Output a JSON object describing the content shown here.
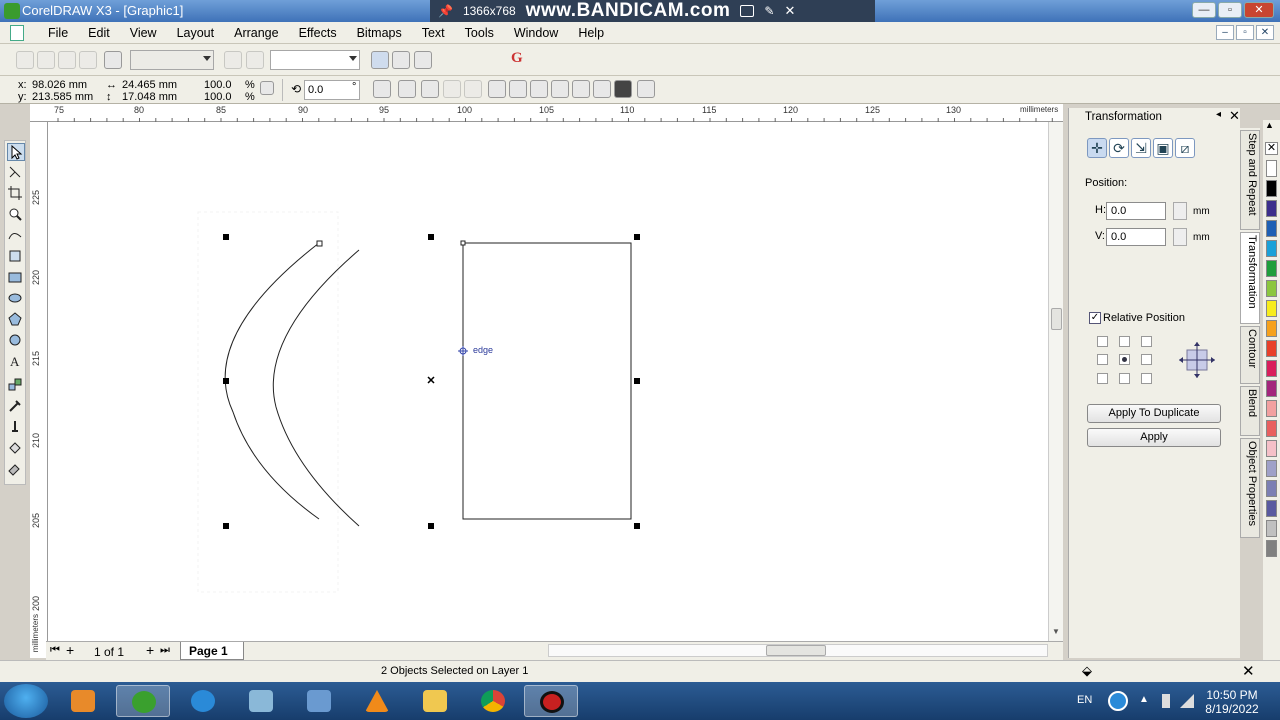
{
  "window": {
    "title": "CorelDRAW X3 - [Graphic1]",
    "recorder_resolution": "1366x768",
    "recorder_brand": "www.BANDICAM.com",
    "min_label": "—",
    "max_label": "▫",
    "close_label": "✕"
  },
  "menu": {
    "items": [
      "File",
      "Edit",
      "View",
      "Layout",
      "Arrange",
      "Effects",
      "Bitmaps",
      "Text",
      "Tools",
      "Window",
      "Help"
    ]
  },
  "toolbar": {
    "x_label": "x:",
    "x_value": "98.026 mm",
    "y_label": "y:",
    "y_value": "213.585 mm",
    "width_value": "24.465 mm",
    "height_value": "17.048 mm",
    "scale_x": "100.0",
    "scale_y": "100.0",
    "percent": "%",
    "rotation": "0.0",
    "degree": "°"
  },
  "rulers": {
    "unit": "millimeters",
    "h_ticks": [
      "75",
      "80",
      "85",
      "90",
      "95",
      "100",
      "105",
      "110",
      "115",
      "120",
      "125",
      "130"
    ],
    "v_ticks": [
      "225",
      "220",
      "215",
      "210",
      "205",
      "200"
    ]
  },
  "canvas": {
    "snap_label": "edge"
  },
  "page_nav": {
    "counter": "1 of 1",
    "page_tab": "Page 1"
  },
  "status": {
    "text": "2 Objects Selected on Layer 1"
  },
  "docker": {
    "title": "Transformation",
    "position_label": "Position:",
    "h_label": "H:",
    "h_value": "0.0",
    "v_label": "V:",
    "v_value": "0.0",
    "unit": "mm",
    "relative_position_label": "Relative Position",
    "relative_position_checked": true,
    "apply_to_duplicate": "Apply To Duplicate",
    "apply": "Apply"
  },
  "side_tabs": [
    "Step and Repeat",
    "Transformation",
    "Contour",
    "Blend",
    "Object Properties"
  ],
  "palette": [
    "#ffffff",
    "#000000",
    "#3c2e8c",
    "#1e5fb4",
    "#1aa0d8",
    "#1f9e3c",
    "#8cc63f",
    "#f7ec1c",
    "#f6a11c",
    "#e8402a",
    "#d81e5b",
    "#a3267c",
    "#f2a0a0",
    "#e86060",
    "#f5c0c8",
    "#9fa0c8",
    "#7c7fb3",
    "#5a5aa0",
    "#c0c0c0",
    "#808080"
  ],
  "taskbar": {
    "lang": "EN",
    "time": "10:50 PM",
    "date": "8/19/2022"
  }
}
